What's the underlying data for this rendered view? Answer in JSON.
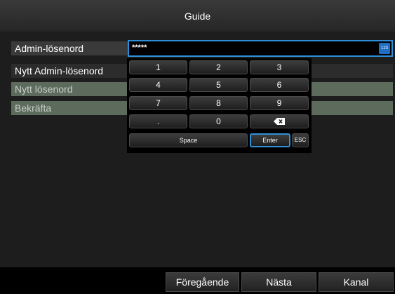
{
  "title": "Guide",
  "form": {
    "admin_password_label": "Admin-lösenord",
    "admin_password_value": "*****",
    "new_admin_password_label": "Nytt Admin-lösenord",
    "new_password_label": "Nytt lösenord",
    "confirm_label": "Bekräfta"
  },
  "input_mode_badge": "123",
  "keypad": {
    "keys": [
      "1",
      "2",
      "3",
      "4",
      "5",
      "6",
      "7",
      "8",
      "9",
      ".",
      "0"
    ],
    "space_label": "Space",
    "enter_label": "Enter",
    "esc_label": "ESC"
  },
  "footer": {
    "previous_label": "Föregående",
    "next_label": "Nästa",
    "channel_label": "Kanal"
  },
  "colors": {
    "accent": "#2e8fd8",
    "row_highlight": "#5d6b5d",
    "row_dark": "#2c2c2c"
  }
}
